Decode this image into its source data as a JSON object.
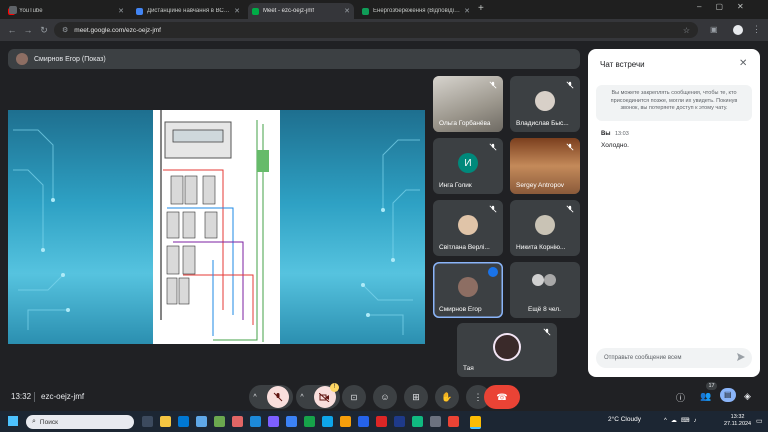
{
  "browser": {
    "tabs": [
      {
        "title": "YouTube",
        "favicon_color": "#ff0000",
        "active": false
      },
      {
        "title": "Дистанційне навчання в ВСП КФФК...",
        "favicon_color": "#4285f4",
        "active": false
      },
      {
        "title": "Meet - ezc-oejz-jmf",
        "favicon_color": "#00ac47",
        "active": true
      },
      {
        "title": "Енергозбереження (Відповіді) - Go...",
        "favicon_color": "#0f9d58",
        "active": false
      }
    ],
    "url": "meet.google.com/ezc-oejz-jmf"
  },
  "meet": {
    "presenter_label": "Смирнов Егор (Показ)",
    "participants": [
      {
        "name": "Ольга Горбанёва",
        "type": "photo",
        "photo_color": "#b0a99a",
        "muted": true
      },
      {
        "name": "Владислав Быс...",
        "type": "photo",
        "photo_color": "#d8d0c8",
        "muted": true
      },
      {
        "name": "Инга Голик",
        "type": "letter",
        "letter": "И",
        "letter_color": "#00897b",
        "muted": true
      },
      {
        "name": "Sergey Antropov",
        "type": "photo",
        "photo_color": "#a0522d",
        "muted": true
      },
      {
        "name": "Світлана Верлі...",
        "type": "photo",
        "photo_color": "#e0c4a8",
        "muted": true
      },
      {
        "name": "Никита Корнію...",
        "type": "photo",
        "photo_color": "#c9c3b5",
        "muted": true
      },
      {
        "name": "Смирнов Егор",
        "type": "photo",
        "photo_color": "#8d6e63",
        "muted": false,
        "speaking": true
      },
      {
        "name": "Ещё 8 чел.",
        "type": "group",
        "photo_color": "#d0d0d0",
        "muted": false
      },
      {
        "name": "Тая",
        "type": "photo",
        "photo_color": "#3a2a2a",
        "muted": true
      }
    ],
    "time": "13:32",
    "meeting_code": "ezc-oejz-jmf",
    "participants_count": "17",
    "raise_badge": "!"
  },
  "chat": {
    "title": "Чат встречи",
    "note": "Вы можете закреплять сообщения, чтобы те, кто присоединится позже, могли их увидеть. Покинув звонок, вы потеряете доступ к этому чату.",
    "messages": [
      {
        "author": "Вы",
        "time": "13:03",
        "text": "Холодно."
      }
    ],
    "input_placeholder": "Отправьте сообщение всем"
  },
  "taskbar": {
    "search_placeholder": "Поиск",
    "weather": "2°C  Cloudy",
    "clock_time": "13:32",
    "clock_date": "27.11.2024"
  },
  "colors": {
    "end_call": "#ea4335",
    "mic_off_bg": "#f9dedc",
    "accent_blue": "#8ab4f8"
  }
}
